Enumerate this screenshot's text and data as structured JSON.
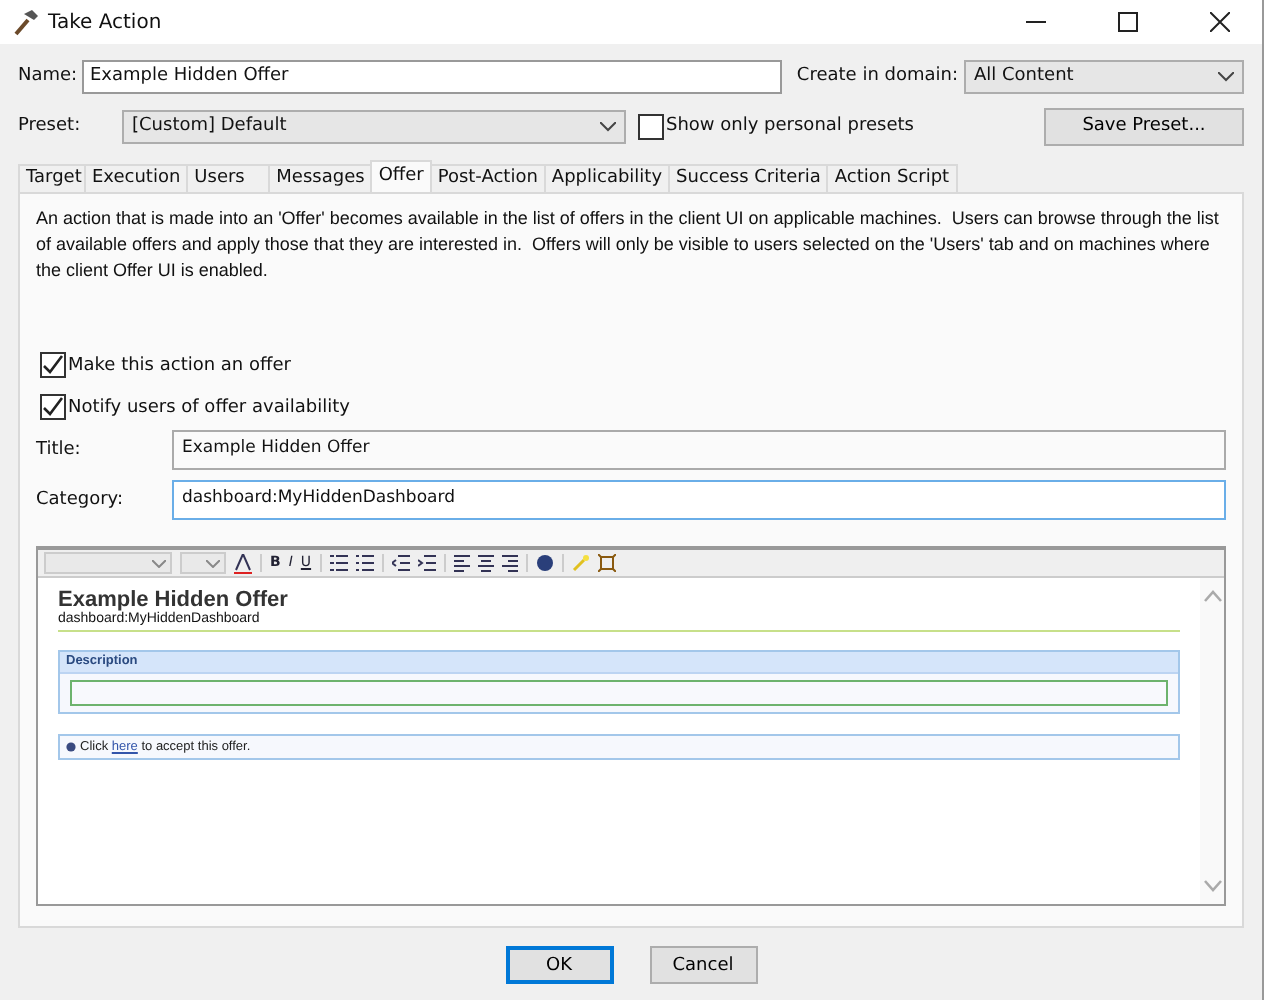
{
  "window": {
    "title": "Take Action"
  },
  "name": {
    "label": "Name:",
    "value": "Example Hidden Offer"
  },
  "domain": {
    "label": "Create in domain:",
    "value": "All Content"
  },
  "preset": {
    "label": "Preset:",
    "value": "[Custom] Default",
    "personal_label": "Show only personal presets",
    "personal_checked": false,
    "save_button": "Save Preset..."
  },
  "tabs": [
    {
      "label": "Target",
      "selected": false
    },
    {
      "label": "Execution",
      "selected": false
    },
    {
      "label": "Users",
      "selected": false
    },
    {
      "label": "Messages",
      "selected": false
    },
    {
      "label": "Offer",
      "selected": true
    },
    {
      "label": "Post-Action",
      "selected": false
    },
    {
      "label": "Applicability",
      "selected": false
    },
    {
      "label": "Success Criteria",
      "selected": false
    },
    {
      "label": "Action Script",
      "selected": false
    }
  ],
  "description": "An action that is made into an 'Offer' becomes available in the list of offers in the client UI on applicable machines.  Users can browse through the list of available offers and apply those that they are interested in.  Offers will only be visible to users selected on the 'Users' tab and on machines where the client Offer UI is enabled.",
  "options": [
    {
      "label": "Make this action an offer",
      "checked": true
    },
    {
      "label": "Notify users of offer availability",
      "checked": true
    }
  ],
  "fields": [
    {
      "label": "Title:",
      "value": "Example Hidden Offer",
      "focused": false
    },
    {
      "label": "Category:",
      "value": "dashboard:MyHiddenDashboard",
      "focused": true
    }
  ],
  "editor": {
    "format_buttons": [
      "B",
      "I",
      "U"
    ],
    "preview_title": "Example Hidden Offer",
    "preview_category": "dashboard:MyHiddenDashboard",
    "description_header": "Description",
    "accept_before": "Click ",
    "accept_link": "here",
    "accept_after": " to accept this offer."
  },
  "buttons": [
    {
      "label": "OK",
      "default": true
    },
    {
      "label": "Cancel",
      "default": false
    }
  ]
}
